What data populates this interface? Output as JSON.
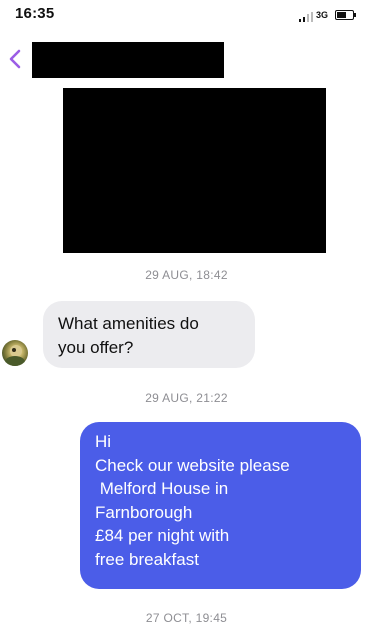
{
  "status_bar": {
    "time": "16:35",
    "network": "3G"
  },
  "header": {
    "back_icon": "chevron-left-icon"
  },
  "colors": {
    "accent": "#9b5de5",
    "outgoing_bubble": "#4b5de8",
    "incoming_bubble": "#ececef",
    "timestamp": "#8e8e93"
  },
  "messages": {
    "timestamp_1": "29 AUG, 18:42",
    "incoming_1": {
      "lines": [
        "What amenities do",
        "you offer?"
      ]
    },
    "timestamp_2": "29 AUG, 21:22",
    "outgoing_1": {
      "lines": [
        "Hi",
        "Check our website please",
        " Melford House in",
        "Farnborough",
        "£84 per night with",
        "free breakfast"
      ]
    },
    "timestamp_3": "27 OCT, 19:45"
  }
}
